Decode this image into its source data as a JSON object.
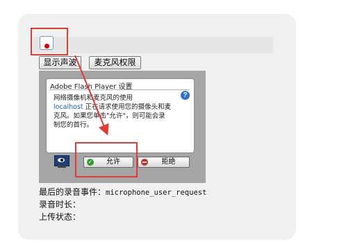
{
  "controls": {
    "show_wave_button": "显示声波",
    "mic_permission_button": "麦克风权限"
  },
  "flash_dialog": {
    "title": "Adobe Flash Player 设置",
    "line1": "网络摄像机和麦克风的使用",
    "host": "localhost",
    "line2_rest": " 正在请求使用您的摄像头和麦",
    "line3": "克风。如果您单击\"允许\"，则可能会录",
    "line4": "制您的首行。",
    "help_glyph": "?",
    "allow_label": "允许",
    "deny_label": "拒绝"
  },
  "status": {
    "last_event_label": "最后的录音事件：",
    "last_event_value": "microphone_user_request",
    "duration_label": "录音时长：",
    "upload_label": "上传状态："
  },
  "colors": {
    "highlight": "#e53935",
    "record_dot": "#e60000",
    "link": "#1a5fb4"
  },
  "icons": {
    "record": "record-dot-icon",
    "help": "help-icon",
    "monitor": "webcam-monitor-icon",
    "allow": "check-circle-icon",
    "deny": "no-entry-icon"
  }
}
